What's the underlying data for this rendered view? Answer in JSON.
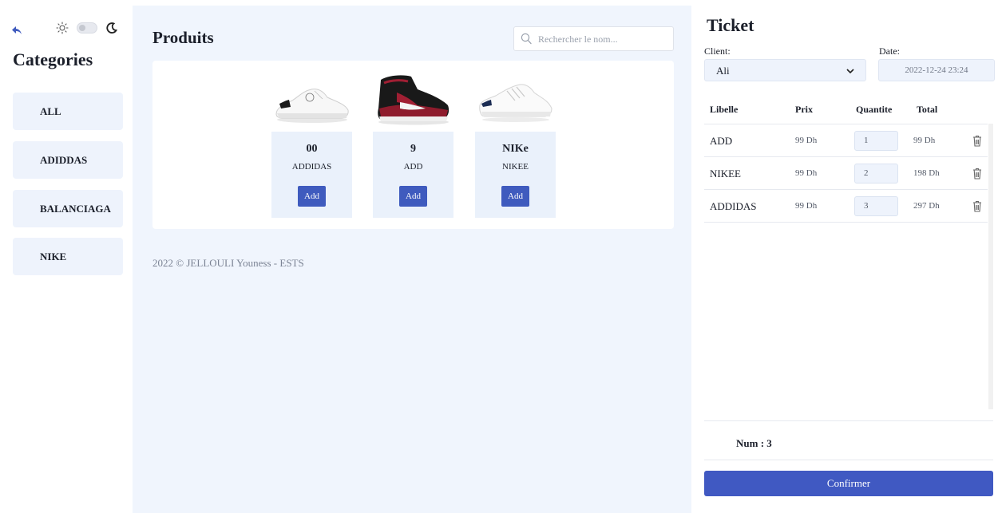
{
  "sidebar": {
    "title": "Categories",
    "theme_toggle_on": false,
    "categories": [
      {
        "label": "ALL"
      },
      {
        "label": "ADIDDAS"
      },
      {
        "label": "BALANCIAGA"
      },
      {
        "label": "NIKE"
      }
    ]
  },
  "main": {
    "title": "Produits",
    "search": {
      "placeholder": "Rechercher le nom...",
      "value": ""
    },
    "products": [
      {
        "name": "00",
        "category": "ADDIDAS",
        "button": "Add",
        "image": "white-sneaker"
      },
      {
        "name": "9",
        "category": "ADD",
        "button": "Add",
        "image": "red-black-high-top-sneaker"
      },
      {
        "name": "NIKe",
        "category": "NIKEE",
        "button": "Add",
        "image": "white-navy-sneaker"
      }
    ],
    "footer": "2022 © JELLOULI Youness - ESTS"
  },
  "ticket": {
    "title": "Ticket",
    "client_label": "Client:",
    "client_value": "Ali",
    "date_label": "Date:",
    "date_value": "2022-12-24 23:24",
    "columns": [
      "Libelle",
      "Prix",
      "Quantite",
      "Total"
    ],
    "rows": [
      {
        "libelle": "ADD",
        "prix": "99 Dh",
        "quantite": "1",
        "total": "99 Dh"
      },
      {
        "libelle": "NIKEE",
        "prix": "99 Dh",
        "quantite": "2",
        "total": "198 Dh"
      },
      {
        "libelle": "ADDIDAS",
        "prix": "99 Dh",
        "quantite": "3",
        "total": "297 Dh"
      }
    ],
    "num": "Num : 3",
    "confirm": "Confirmer"
  },
  "colors": {
    "accent": "#3f5bbe",
    "main_bg": "#f0f5fd",
    "card_bg": "#eaf1fb"
  }
}
